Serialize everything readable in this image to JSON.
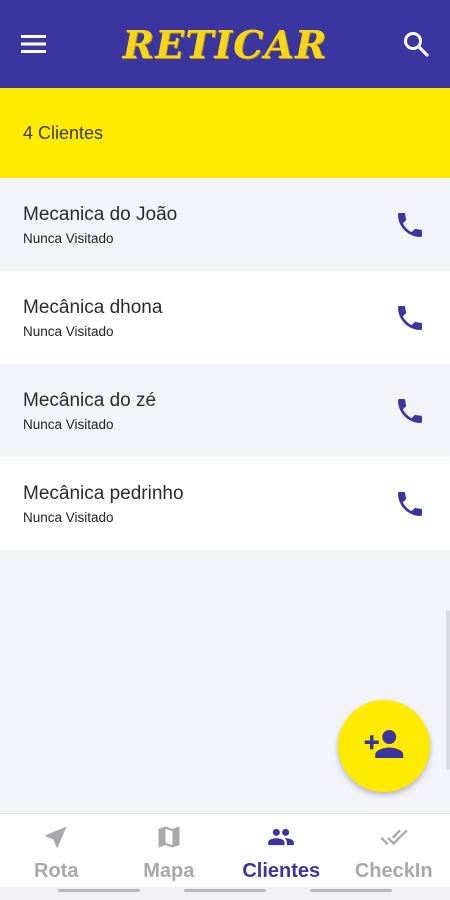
{
  "app": {
    "logo": "RETICAR",
    "brand_color": "#3b359f",
    "accent_color": "#ffeb00"
  },
  "appbar": {
    "menu_icon": "menu-icon",
    "search_icon": "search-icon"
  },
  "summary": {
    "text": "4 Clientes"
  },
  "clients": [
    {
      "name": "Mecanica do João",
      "status": "Nunca Visitado"
    },
    {
      "name": "Mecânica dhona",
      "status": "Nunca Visitado"
    },
    {
      "name": "Mecânica do zé",
      "status": "Nunca Visitado"
    },
    {
      "name": "Mecânica pedrinho",
      "status": "Nunca Visitado"
    }
  ],
  "fab": {
    "icon": "add-person-icon"
  },
  "bottom_nav": {
    "items": [
      {
        "label": "Rota",
        "icon": "navigation-arrow-icon",
        "active": false
      },
      {
        "label": "Mapa",
        "icon": "map-icon",
        "active": false
      },
      {
        "label": "Clientes",
        "icon": "people-icon",
        "active": true
      },
      {
        "label": "CheckIn",
        "icon": "double-check-icon",
        "active": false
      }
    ]
  }
}
